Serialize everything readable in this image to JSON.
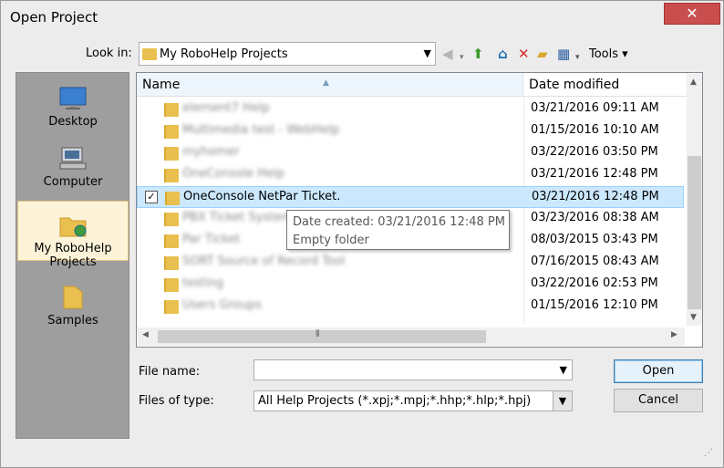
{
  "window": {
    "title": "Open Project",
    "close_label": "✕"
  },
  "lookin": {
    "label": "Look in:",
    "value": "My RoboHelp Projects"
  },
  "toolbar": {
    "tools_label": "Tools ▾"
  },
  "places": [
    {
      "label": "Desktop"
    },
    {
      "label": "Computer"
    },
    {
      "label": "My RoboHelp Projects"
    },
    {
      "label": "Samples"
    }
  ],
  "columns": {
    "name": "Name",
    "date": "Date modified"
  },
  "files": [
    {
      "name": "element7 Help",
      "date": "03/21/2016 09:11 AM",
      "blurred": true
    },
    {
      "name": "Multimedia test - WebHelp",
      "date": "01/15/2016 10:10 AM",
      "blurred": true
    },
    {
      "name": "myhomer",
      "date": "03/22/2016 03:50 PM",
      "blurred": true
    },
    {
      "name": "OneConsole Help",
      "date": "03/21/2016 12:48 PM",
      "blurred": true
    },
    {
      "name": "OneConsole NetPar Ticket.",
      "date": "03/21/2016 12:48 PM",
      "blurred": false
    },
    {
      "name": "PBX Ticket System",
      "date": "03/23/2016 08:38 AM",
      "blurred": true
    },
    {
      "name": "Par Ticket",
      "date": "08/03/2015 03:43 PM",
      "blurred": true
    },
    {
      "name": "SORT Source of Record Tool",
      "date": "07/16/2015 08:43 AM",
      "blurred": true
    },
    {
      "name": "testing",
      "date": "03/22/2016 02:53 PM",
      "blurred": true
    },
    {
      "name": "Users Groups",
      "date": "01/15/2016 12:10 PM",
      "blurred": true
    }
  ],
  "tooltip": {
    "line1": "Date created: 03/21/2016 12:48 PM",
    "line2": "Empty folder"
  },
  "filename": {
    "label": "File name:",
    "value": ""
  },
  "filetype": {
    "label": "Files of type:",
    "value": "All Help Projects (*.xpj;*.mpj;*.hhp;*.hlp;*.hpj)"
  },
  "buttons": {
    "open": "Open",
    "cancel": "Cancel"
  },
  "colors": {
    "selection": "#cce8ff",
    "close": "#c94f4f",
    "places_bg": "#9e9e9e",
    "folder": "#e9c04f"
  }
}
